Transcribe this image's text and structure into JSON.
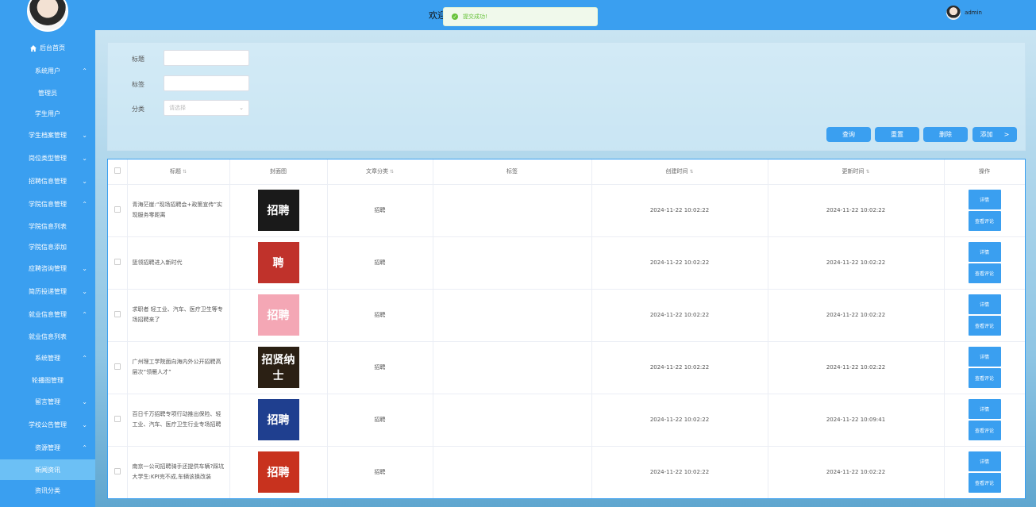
{
  "header": {
    "title": "欢迎",
    "toast": "提交成功!",
    "user": "admin"
  },
  "sidebar": {
    "items": [
      {
        "label": "后台首页",
        "type": "item",
        "chev": "",
        "icon": "home-icon"
      },
      {
        "label": "系统用户",
        "type": "item",
        "chev": "^"
      },
      {
        "label": "管理员",
        "type": "sub"
      },
      {
        "label": "学生用户",
        "type": "sub"
      },
      {
        "label": "学生档案管理",
        "type": "item",
        "chev": "v"
      },
      {
        "label": "岗位类型管理",
        "type": "item",
        "chev": "v"
      },
      {
        "label": "招聘信息管理",
        "type": "item",
        "chev": "v"
      },
      {
        "label": "学院信息管理",
        "type": "item",
        "chev": "^"
      },
      {
        "label": "学院信息列表",
        "type": "sub"
      },
      {
        "label": "学院信息添加",
        "type": "sub"
      },
      {
        "label": "应聘咨询管理",
        "type": "item",
        "chev": "v"
      },
      {
        "label": "简历投递管理",
        "type": "item",
        "chev": "v"
      },
      {
        "label": "就业信息管理",
        "type": "item",
        "chev": "^"
      },
      {
        "label": "就业信息列表",
        "type": "sub"
      },
      {
        "label": "系统管理",
        "type": "item",
        "chev": "^"
      },
      {
        "label": "轮播图管理",
        "type": "sub"
      },
      {
        "label": "留言管理",
        "type": "item",
        "chev": "v"
      },
      {
        "label": "学校公告管理",
        "type": "item",
        "chev": "v"
      },
      {
        "label": "资源管理",
        "type": "item",
        "chev": "^"
      },
      {
        "label": "新闻资讯",
        "type": "sub",
        "active": true
      },
      {
        "label": "资讯分类",
        "type": "sub"
      }
    ]
  },
  "search": {
    "title_label": "标题",
    "tag_label": "标签",
    "category_label": "分类",
    "category_placeholder": "请选择",
    "buttons": [
      "查询",
      "重置",
      "删除",
      "添加"
    ]
  },
  "table": {
    "columns": [
      "标题",
      "封面图",
      "文章分类",
      "标签",
      "创建时间",
      "更新时间",
      "操作"
    ],
    "op_detail": "详情",
    "op_comment": "查看评论",
    "rows": [
      {
        "title": "青海茫崖:“现场招聘会+政策宣传”实现服务零距离",
        "category": "招聘",
        "tag": "",
        "created": "2024-11-22 10:02:22",
        "updated": "2024-11-22 10:02:22",
        "cover_text": "招聘",
        "cover_color": "#1a1a1a"
      },
      {
        "title": "篮领招聘进入新时代",
        "category": "招聘",
        "tag": "",
        "created": "2024-11-22 10:02:22",
        "updated": "2024-11-22 10:02:22",
        "cover_text": "聘",
        "cover_color": "#c0322b"
      },
      {
        "title": "求职者 轻工业、汽车、医疗卫生等专场招聘来了",
        "category": "招聘",
        "tag": "",
        "created": "2024-11-22 10:02:22",
        "updated": "2024-11-22 10:02:22",
        "cover_text": "招聘",
        "cover_color": "#f4a7b5"
      },
      {
        "title": "广州理工学院面向海内外公开招聘高层次“领雁人才”",
        "category": "招聘",
        "tag": "",
        "created": "2024-11-22 10:02:22",
        "updated": "2024-11-22 10:02:22",
        "cover_text": "招贤纳士",
        "cover_color": "#2b2014"
      },
      {
        "title": "百日千万招聘专项行动推出保险、轻工业、汽车、医疗卫生行业专场招聘",
        "category": "招聘",
        "tag": "",
        "created": "2024-11-22 10:02:22",
        "updated": "2024-11-22 10:09:41",
        "cover_text": "招聘",
        "cover_color": "#1f3f8f"
      },
      {
        "title": "南京一公司招聘骑手还提供车辆?踩坑大学生:KPI完不成,车辆该换改装",
        "category": "招聘",
        "tag": "",
        "created": "2024-11-22 10:02:22",
        "updated": "2024-11-22 10:02:22",
        "cover_text": "招聘",
        "cover_color": "#c8321e"
      }
    ]
  }
}
